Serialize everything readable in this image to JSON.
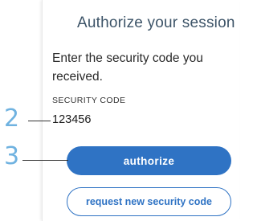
{
  "dialog": {
    "title": "Authorize your session",
    "instructions": "Enter the security code you received.",
    "field_label": "SECURITY CODE",
    "field_value": "123456",
    "authorize_label": "authorize",
    "request_new_label": "request new security code"
  },
  "callouts": {
    "field_marker": "2",
    "button_marker": "3"
  },
  "colors": {
    "title": "#3d5468",
    "accent": "#2f73c4",
    "callout": "#6fb2e0"
  }
}
